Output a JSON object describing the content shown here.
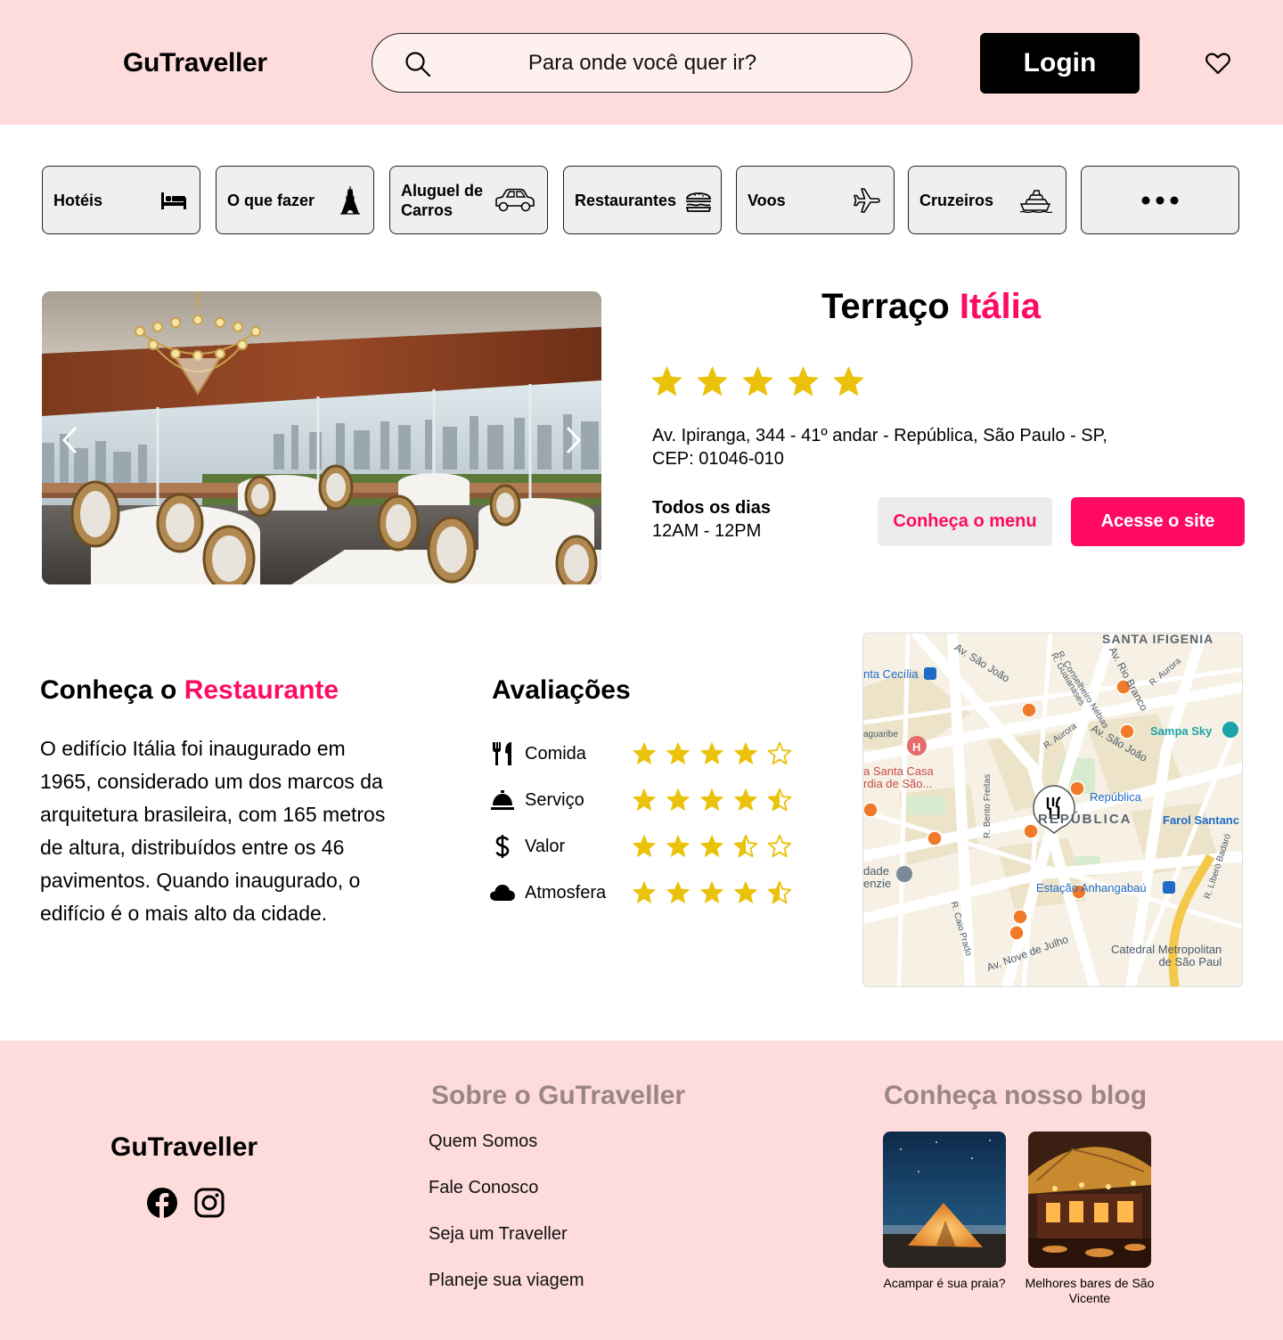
{
  "header": {
    "logo": "GuTraveller",
    "search_placeholder": "Para onde você quer ir?",
    "login_label": "Login"
  },
  "categories": [
    {
      "label": "Hotéis",
      "icon": "bed-icon"
    },
    {
      "label": "O que fazer",
      "icon": "eiffel-tower-icon"
    },
    {
      "label": "Aluguel de Carros",
      "icon": "car-icon"
    },
    {
      "label": "Restaurantes",
      "icon": "burger-icon"
    },
    {
      "label": "Voos",
      "icon": "airplane-icon"
    },
    {
      "label": "Cruzeiros",
      "icon": "ship-icon"
    },
    {
      "label": "",
      "icon": "more-icon"
    }
  ],
  "restaurant": {
    "title_part1": "Terraço",
    "title_part2": "Itália",
    "rating": 5,
    "address_line1": "Av. Ipiranga, 344 - 41º andar - República, São Paulo - SP,",
    "address_line2": "CEP: 01046-010",
    "hours_title": "Todos os dias",
    "hours_value": "12AM - 12PM",
    "menu_button": "Conheça o menu",
    "site_button": "Acesse o site"
  },
  "about": {
    "title_part1": "Conheça o",
    "title_part2": "Restaurante",
    "text": "O edifício Itália foi inaugurado em 1965, considerado um dos marcos da arquitetura brasileira, com 165 metros de altura, distribuídos entre os 46 pavimentos. Quando inaugurado, o edifício é o mais alto da cidade."
  },
  "reviews": {
    "title": "Avaliações",
    "items": [
      {
        "label": "Comida",
        "icon": "utensils-icon",
        "rating": 4
      },
      {
        "label": "Serviço",
        "icon": "service-bell-icon",
        "rating": 4.5
      },
      {
        "label": "Valor",
        "icon": "dollar-icon",
        "rating": 3.5
      },
      {
        "label": "Atmosfera",
        "icon": "cloud-icon",
        "rating": 4.5
      }
    ]
  },
  "map": {
    "labels": {
      "santa_ifigenia": "SANTA IFIGENIA",
      "sao_joao": "Av. São João",
      "sao_joao2": "Av. São João",
      "santa_cecilia": "nta Cecília",
      "guaianases": "R. Guaianases",
      "conselheiro": "R. Conselheiro Nébias",
      "rio_branco": "Av. Rio Branco",
      "aurora": "R. Aurora",
      "aurora2": "R. Aurora",
      "sampa_sky": "Sampa Sky",
      "aguaribe": "aguaribe",
      "santa_casa": "a Santa Casa\nrdia de São...",
      "bento_freitas": "R. Bento Freitas",
      "republica": "República",
      "republica_big": "REPÚBLICA",
      "farol": "Farol Santanc",
      "libero": "R. Líbero Badaró",
      "dade": "dade\nenzie",
      "estacao": "Estação Anhangabaú",
      "caio_prado": "R. Caio Prado",
      "nove_julho": "Av. Nove de Julho",
      "catedral": "Catedral Metropolitan\nde São Paul"
    }
  },
  "footer": {
    "logo": "GuTraveller",
    "about_title": "Sobre o GuTraveller",
    "links": [
      "Quem Somos",
      "Fale Conosco",
      "Seja um Traveller",
      "Planeje sua viagem"
    ],
    "blog_title": "Conheça nosso blog",
    "blog_posts": [
      "Acampar é sua praia?",
      "Melhores bares de São Vicente"
    ]
  },
  "colors": {
    "accent": "#ff0a63",
    "header_bg": "#fddcdb",
    "star": "#eac20a",
    "footer_heading": "#9a8587"
  }
}
